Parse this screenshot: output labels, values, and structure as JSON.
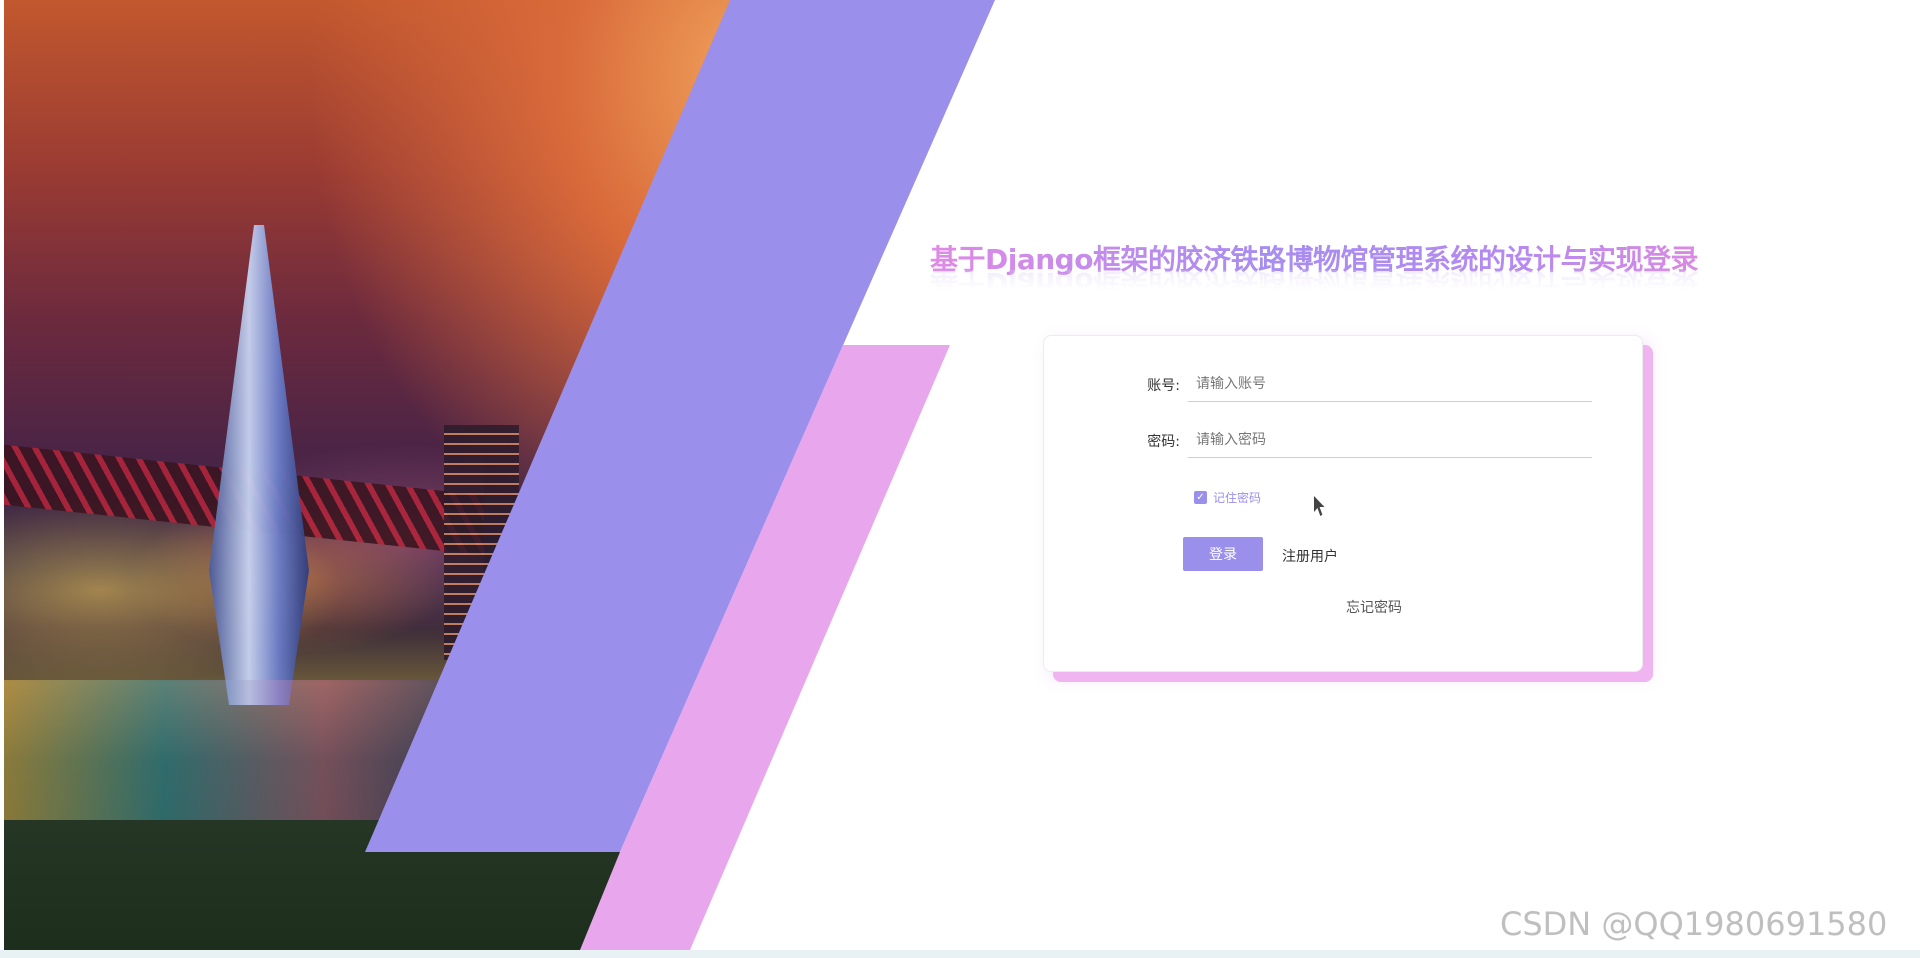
{
  "title": "基于Django框架的胶济铁路博物馆管理系统的设计与实现登录",
  "form": {
    "account_label": "账号:",
    "account_placeholder": "请输入账号",
    "password_label": "密码:",
    "password_placeholder": "请输入密码",
    "remember_label": "记住密码",
    "remember_checked": true,
    "login_button": "登录",
    "register_link": "注册用户",
    "forgot_link": "忘记密码"
  },
  "watermark": "CSDN @QQ1980691580",
  "colors": {
    "accent_purple": "#9b8fec",
    "accent_pink": "#e8a7ec"
  },
  "icons": {
    "checkbox": "check-icon",
    "pointer": "mouse-cursor-icon"
  }
}
